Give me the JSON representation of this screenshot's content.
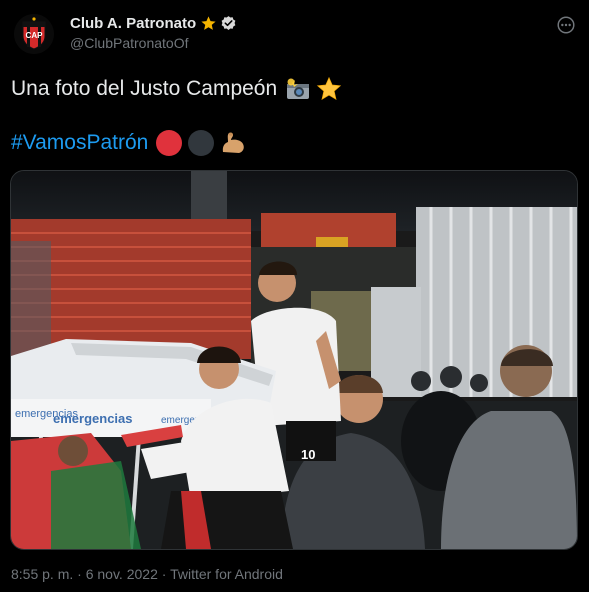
{
  "header": {
    "display_name": "Club A. Patronato",
    "handle": "@ClubPatronatoOf",
    "avatar_text": "CAP"
  },
  "tweet": {
    "text": "Una foto del Justo Campeón",
    "hashtag": "#VamosPatrón",
    "emojis": [
      "camera-with-flash-icon",
      "star-icon",
      "red-circle-icon",
      "black-circle-icon",
      "flexed-biceps-icon"
    ]
  },
  "photo": {
    "banner_text_1": "emergencias",
    "banner_text_2": "emergencias",
    "banner_text_3": "emergencias",
    "player_number": "10"
  },
  "meta": {
    "time": "8:55 p. m.",
    "separator_1": " · ",
    "date": "6 nov. 2022",
    "separator_2": " · ",
    "source": "Twitter for Android"
  },
  "colors": {
    "background": "#000000",
    "text": "#e7e9ea",
    "secondary": "#71767b",
    "link": "#1d9bf0",
    "star": "#f4b400",
    "club_red": "#e0323c"
  }
}
